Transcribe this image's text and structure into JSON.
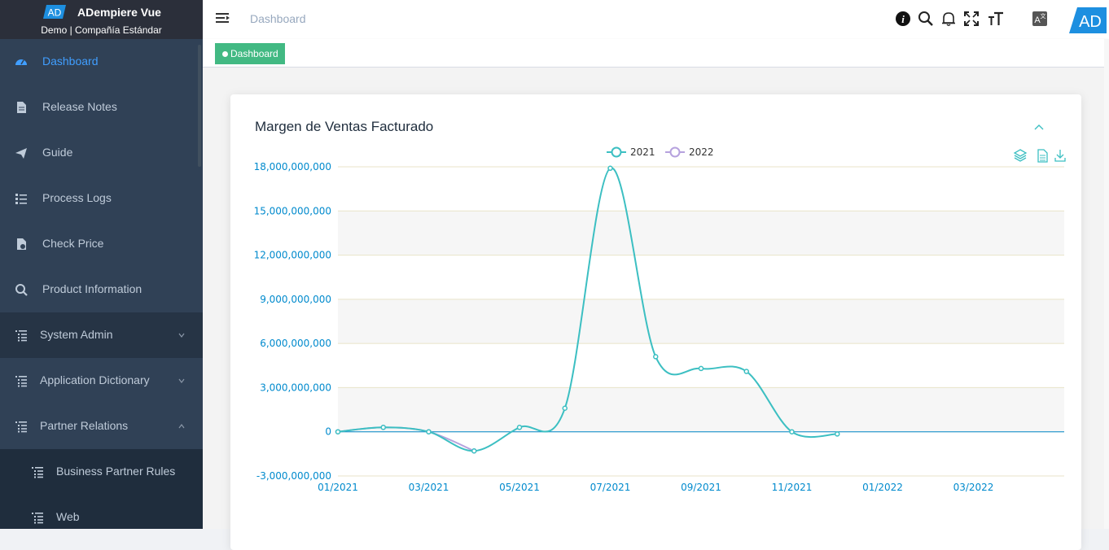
{
  "brand": {
    "title": "ADempiere Vue",
    "subtitle": "Demo | Compañía Estándar",
    "logo_text": "AD"
  },
  "sidebar": {
    "items": [
      {
        "label": "Dashboard",
        "icon": "dashboard-icon",
        "active": true
      },
      {
        "label": "Release Notes",
        "icon": "document-icon"
      },
      {
        "label": "Guide",
        "icon": "send-icon"
      },
      {
        "label": "Process Logs",
        "icon": "list-check-icon"
      },
      {
        "label": "Check Price",
        "icon": "price-document-icon"
      },
      {
        "label": "Product Information",
        "icon": "search-icon"
      },
      {
        "label": "System Admin",
        "icon": "tree-list-icon",
        "expandable": true,
        "expanded": false
      },
      {
        "label": "Application Dictionary",
        "icon": "tree-list-icon",
        "expandable": true,
        "expanded": false
      },
      {
        "label": "Partner Relations",
        "icon": "tree-list-icon",
        "expandable": true,
        "expanded": true
      },
      {
        "label": "Business Partner Rules",
        "icon": "tree-list-icon",
        "child": true
      },
      {
        "label": "Web",
        "icon": "tree-list-icon",
        "child": true
      }
    ]
  },
  "header": {
    "breadcrumb": "Dashboard",
    "icons": [
      "info-icon",
      "search-icon",
      "bell-icon",
      "fullscreen-icon",
      "text-size-icon",
      "translate-icon"
    ],
    "logo_text": "AD"
  },
  "tags": [
    {
      "label": "Dashboard",
      "active": true
    }
  ],
  "card": {
    "title": "Margen de Ventas Facturado",
    "toolbox_icons": [
      "stack-icon",
      "data-view-icon",
      "download-icon"
    ]
  },
  "colors": {
    "series_2021": "#3cbfc2",
    "series_2022": "#b6a2de",
    "axis_text": "#008acd",
    "sidebar_bg": "#304156",
    "tag_bg": "#42b983"
  },
  "chart_data": {
    "type": "line",
    "title": "",
    "xlabel": "",
    "ylabel": "",
    "legend_position": "top-center",
    "x_tick_labels": [
      "01/2021",
      "03/2021",
      "05/2021",
      "07/2021",
      "09/2021",
      "11/2021",
      "01/2022",
      "03/2022"
    ],
    "categories": [
      "01/2021",
      "02/2021",
      "03/2021",
      "04/2021",
      "05/2021",
      "06/2021",
      "07/2021",
      "08/2021",
      "09/2021",
      "10/2021",
      "11/2021",
      "12/2021",
      "01/2022",
      "02/2022",
      "03/2022",
      "04/2022"
    ],
    "y_tick_labels": [
      "-3,000,000,000",
      "0",
      "3,000,000,000",
      "6,000,000,000",
      "9,000,000,000",
      "12,000,000,000",
      "15,000,000,000",
      "18,000,000,000"
    ],
    "ylim": [
      -3000000000,
      18000000000
    ],
    "grid": true,
    "series": [
      {
        "name": "2021",
        "values": [
          0,
          300000000,
          0,
          -1300000000,
          300000000,
          1600000000,
          17900000000,
          5100000000,
          4300000000,
          4100000000,
          0,
          -150000000
        ]
      },
      {
        "name": "2022",
        "values": [
          0,
          300000000,
          0,
          -1300000000
        ]
      }
    ]
  }
}
